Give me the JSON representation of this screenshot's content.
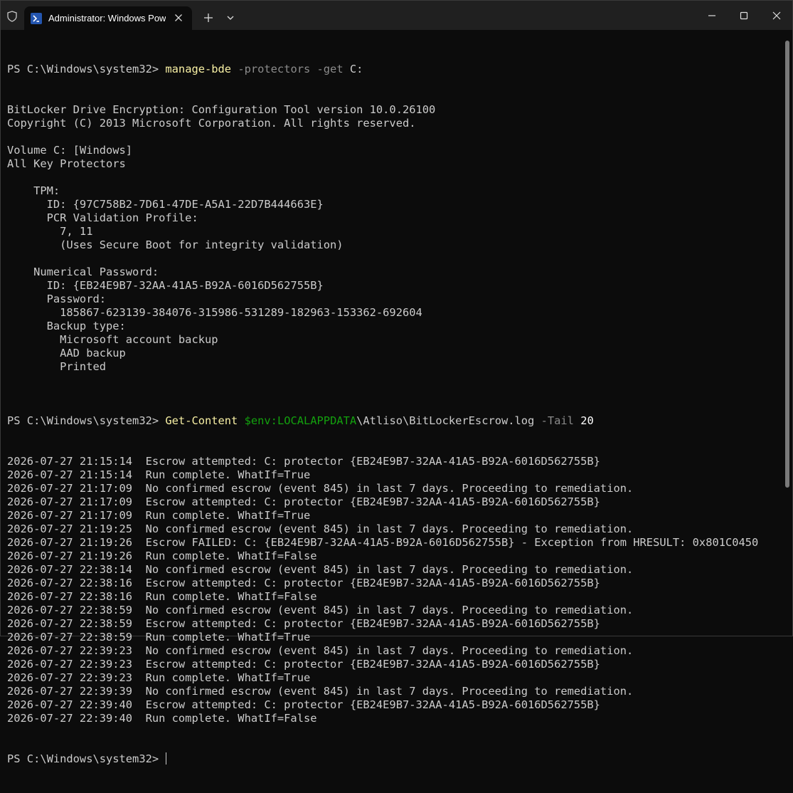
{
  "window": {
    "tab_title": "Administrator: Windows PowerShell",
    "colors": {
      "background": "#0c0c0c",
      "titlebar": "#202020",
      "text": "#cccccc",
      "command": "#f9f1a5",
      "parameter": "#8c8c8c",
      "variable": "#13a10e",
      "number": "#ffffff"
    },
    "icons": [
      "shield-icon",
      "powershell-icon",
      "close-icon",
      "plus-icon",
      "chevron-down-icon",
      "minimize-icon",
      "maximize-icon",
      "window-close-icon"
    ]
  },
  "terminal": {
    "cmd1": {
      "prompt": "PS C:\\Windows\\system32> ",
      "command": "manage-bde",
      "param": " -protectors -get",
      "args": " C:"
    },
    "output1": [
      "BitLocker Drive Encryption: Configuration Tool version 10.0.26100",
      "Copyright (C) 2013 Microsoft Corporation. All rights reserved.",
      "",
      "Volume C: [Windows]",
      "All Key Protectors",
      "",
      "    TPM:",
      "      ID: {97C758B2-7D61-47DE-A5A1-22D7B444663E}",
      "      PCR Validation Profile:",
      "        7, 11",
      "        (Uses Secure Boot for integrity validation)",
      "",
      "    Numerical Password:",
      "      ID: {EB24E9B7-32AA-41A5-B92A-6016D562755B}",
      "      Password:",
      "        185867-623139-384076-315986-531289-182963-153362-692604",
      "      Backup type:",
      "        Microsoft account backup",
      "        AAD backup",
      "        Printed",
      ""
    ],
    "cmd2": {
      "prompt": "PS C:\\Windows\\system32> ",
      "command": "Get-Content",
      "space1": " ",
      "variable": "$env:LOCALAPPDATA",
      "path": "\\Atliso\\BitLockerEscrow.log",
      "param": " -Tail",
      "space2": " ",
      "number": "20"
    },
    "output2": [
      "2026-07-27 21:15:14  Escrow attempted: C: protector {EB24E9B7-32AA-41A5-B92A-6016D562755B}",
      "2026-07-27 21:15:14  Run complete. WhatIf=True",
      "2026-07-27 21:17:09  No confirmed escrow (event 845) in last 7 days. Proceeding to remediation.",
      "2026-07-27 21:17:09  Escrow attempted: C: protector {EB24E9B7-32AA-41A5-B92A-6016D562755B}",
      "2026-07-27 21:17:09  Run complete. WhatIf=True",
      "2026-07-27 21:19:25  No confirmed escrow (event 845) in last 7 days. Proceeding to remediation.",
      "2026-07-27 21:19:26  Escrow FAILED: C: {EB24E9B7-32AA-41A5-B92A-6016D562755B} - Exception from HRESULT: 0x801C0450",
      "2026-07-27 21:19:26  Run complete. WhatIf=False",
      "2026-07-27 22:38:14  No confirmed escrow (event 845) in last 7 days. Proceeding to remediation.",
      "2026-07-27 22:38:16  Escrow attempted: C: protector {EB24E9B7-32AA-41A5-B92A-6016D562755B}",
      "2026-07-27 22:38:16  Run complete. WhatIf=False",
      "2026-07-27 22:38:59  No confirmed escrow (event 845) in last 7 days. Proceeding to remediation.",
      "2026-07-27 22:38:59  Escrow attempted: C: protector {EB24E9B7-32AA-41A5-B92A-6016D562755B}",
      "2026-07-27 22:38:59  Run complete. WhatIf=True",
      "2026-07-27 22:39:23  No confirmed escrow (event 845) in last 7 days. Proceeding to remediation.",
      "2026-07-27 22:39:23  Escrow attempted: C: protector {EB24E9B7-32AA-41A5-B92A-6016D562755B}",
      "2026-07-27 22:39:23  Run complete. WhatIf=True",
      "2026-07-27 22:39:39  No confirmed escrow (event 845) in last 7 days. Proceeding to remediation.",
      "2026-07-27 22:39:40  Escrow attempted: C: protector {EB24E9B7-32AA-41A5-B92A-6016D562755B}",
      "2026-07-27 22:39:40  Run complete. WhatIf=False"
    ],
    "final_prompt": "PS C:\\Windows\\system32> "
  }
}
